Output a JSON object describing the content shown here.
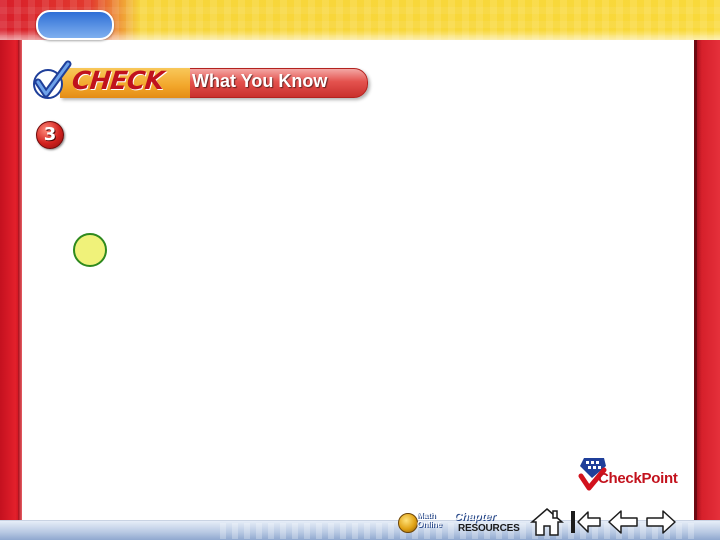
{
  "header": {
    "check_word": "CHECK",
    "subtitle": "What You Know"
  },
  "question": {
    "number": "3"
  },
  "logo": {
    "text": "CheckPoint"
  },
  "nav": {
    "math_online_line1": "Math",
    "math_online_line2": "Online",
    "chapter_line1": "Chapter",
    "chapter_line2": "RESOURCES"
  },
  "icons": {
    "home": "home-icon",
    "first": "first-slide-icon",
    "prev": "previous-arrow-icon",
    "next": "next-arrow-icon",
    "check": "checkmark-icon",
    "globe": "globe-icon"
  },
  "colors": {
    "frame_red": "#e3202b",
    "banner_yellow": "#f9d93a",
    "circle_fill": "#f0f27a",
    "circle_stroke": "#2f8a1e",
    "nav_bar": "#b7c8e2"
  }
}
